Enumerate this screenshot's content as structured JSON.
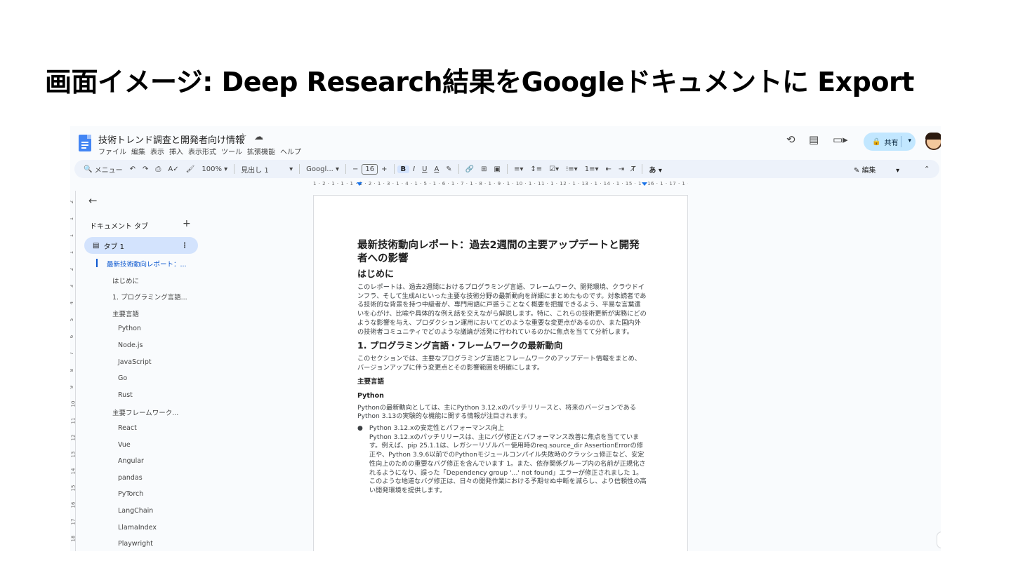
{
  "slide": {
    "title": "画面イメージ: Deep Research結果をGoogleドキュメントに Export"
  },
  "doc": {
    "title": "技術トレンド調査と開発者向け情報",
    "menu": [
      "ファイル",
      "編集",
      "表示",
      "挿入",
      "表示形式",
      "ツール",
      "拡張機能",
      "ヘルプ"
    ],
    "share_label": "共有"
  },
  "toolbar": {
    "menu_label": "メニュー",
    "zoom": "100%",
    "style": "見出し 1",
    "font": "Googl...",
    "font_size": "16",
    "edit_mode": "編集"
  },
  "sidebar": {
    "tabs_label": "ドキュメント タブ",
    "tab_name": "タブ 1",
    "outline": [
      {
        "label": "最新技術動向レポート：...",
        "level": 0,
        "active": true
      },
      {
        "label": "はじめに",
        "level": 1
      },
      {
        "label": "1. プログラミング言語...",
        "level": 1
      },
      {
        "label": "主要言語",
        "level": 2
      },
      {
        "label": "Python",
        "level": 3
      },
      {
        "label": "Node.js",
        "level": 3
      },
      {
        "label": "JavaScript",
        "level": 3
      },
      {
        "label": "Go",
        "level": 3
      },
      {
        "label": "Rust",
        "level": 3
      },
      {
        "label": "主要フレームワーク...",
        "level": 2
      },
      {
        "label": "React",
        "level": 3
      },
      {
        "label": "Vue",
        "level": 3
      },
      {
        "label": "Angular",
        "level": 3
      },
      {
        "label": "pandas",
        "level": 3
      },
      {
        "label": "PyTorch",
        "level": 3
      },
      {
        "label": "LangChain",
        "level": 3
      },
      {
        "label": "LlamaIndex",
        "level": 3
      },
      {
        "label": "Playwright",
        "level": 3
      }
    ]
  },
  "content": {
    "title": "最新技術動向レポート：過去2週間の主要アップデートと開発者への影響",
    "intro_heading": "はじめに",
    "intro_text": "このレポートは、過去2週間におけるプログラミング言語、フレームワーク、開発環境、クラウドインフラ、そして生成AIといった主要な技術分野の最新動向を詳細にまとめたものです。対象読者である技術的な背景を持つ中級者が、専門用語に戸惑うことなく概要を把握できるよう、平易な言葉遣いを心がけ、比喩や具体的な例え話を交えながら解説します。特に、これらの技術更新が実務にどのような影響を与え、プロダクション運用においてどのような重要な変更点があるのか、また国内外の技術者コミュニティでどのような議論が活発に行われているのかに焦点を当てて分析します。",
    "section1_heading": "1. プログラミング言語・フレームワークの最新動向",
    "section1_text": "このセクションでは、主要なプログラミング言語とフレームワークのアップデート情報をまとめ、バージョンアップに伴う変更点とその影響範囲を明確にします。",
    "lang_heading": "主要言語",
    "python_heading": "Python",
    "python_text": "Pythonの最新動向としては、主にPython 3.12.xのパッチリリースと、将来のバージョンであるPython 3.13の実験的な機能に関する情報が注目されます。",
    "bullet_title": "Python 3.12.xの安定性とパフォーマンス向上",
    "bullet_text": "Python 3.12.xのパッチリリースは、主にバグ修正とパフォーマンス改善に焦点を当てています。例えば、pip 25.1.1は、レガシーリゾルバー使用時のreq.source_dir AssertionErrorの修正や、Python 3.9.6以前でのPythonモジュールコンパイル失敗時のクラッシュ修正など、安定性向上のための重要なバグ修正を含んでいます 1。また、依存関係グループ内の名前が正規化されるようになり、誤った「Dependency group '...' not found」エラーが修正されました 1。このような地道なバグ修正は、日々の開発作業における予期せぬ中断を減らし、より信頼性の高い開発環境を提供します。"
  }
}
